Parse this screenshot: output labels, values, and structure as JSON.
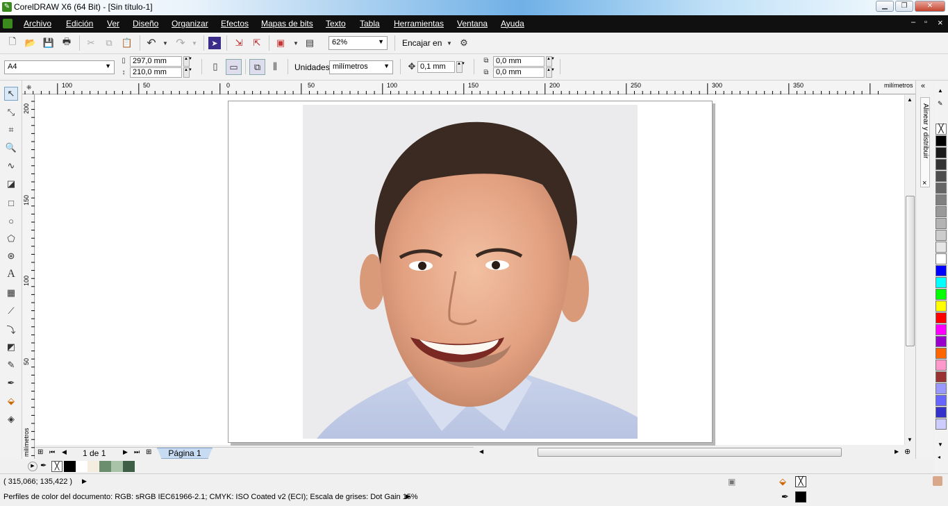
{
  "window": {
    "title": "CorelDRAW X6 (64 Bit) - [Sin título-1]",
    "min": "▁",
    "max": "❐",
    "close": "✕"
  },
  "menu": {
    "items": [
      "Archivo",
      "Edición",
      "Ver",
      "Diseño",
      "Organizar",
      "Efectos",
      "Mapas de bits",
      "Texto",
      "Tabla",
      "Herramientas",
      "Ventana",
      "Ayuda"
    ],
    "doc_min": "–",
    "doc_max": "▫",
    "doc_close": "×"
  },
  "toolbar": {
    "zoom": "62%",
    "snap": "Encajar en"
  },
  "propbar": {
    "page_size": "A4",
    "width": "297,0 mm",
    "height": "210,0 mm",
    "units_label": "Unidades:",
    "units": "milímetros",
    "nudge": "0,1 mm",
    "dup_x": "0,0 mm",
    "dup_y": "0,0 mm"
  },
  "ruler": {
    "h_labels": [
      "100",
      "50",
      "0",
      "50",
      "100",
      "150",
      "200",
      "250",
      "300",
      "350"
    ],
    "h_unit": "milímetros",
    "v_labels": [
      "200",
      "150",
      "100",
      "50"
    ],
    "v_unit": "milímetros"
  },
  "docker": {
    "title": "Alinear y distribuir"
  },
  "pagenav": {
    "counter": "1 de 1",
    "tab": "Página 1"
  },
  "status": {
    "coords": "( 315,066; 135,422 )",
    "profile": "Perfiles de color del documento: RGB: sRGB IEC61966-2.1; CMYK: ISO Coated v2 (ECI); Escala de grises: Dot Gain 15%"
  },
  "palette_colors": [
    "#000000",
    "#1a1a1a",
    "#333333",
    "#4d4d4d",
    "#666666",
    "#808080",
    "#999999",
    "#b3b3b3",
    "#cccccc",
    "#e6e6e6",
    "#ffffff",
    "#0000ff",
    "#00ffff",
    "#00ff00",
    "#ffff00",
    "#ff0000",
    "#ff00ff",
    "#9900cc",
    "#ff6600",
    "#ff99cc",
    "#993333",
    "#9999ff",
    "#6666ff",
    "#3333cc",
    "#ccccff"
  ],
  "doc_palette_colors": [
    "#000000",
    "#ffffff",
    "#f5ede0",
    "#6b8f6e",
    "#a9c3a9",
    "#3e5e45"
  ]
}
